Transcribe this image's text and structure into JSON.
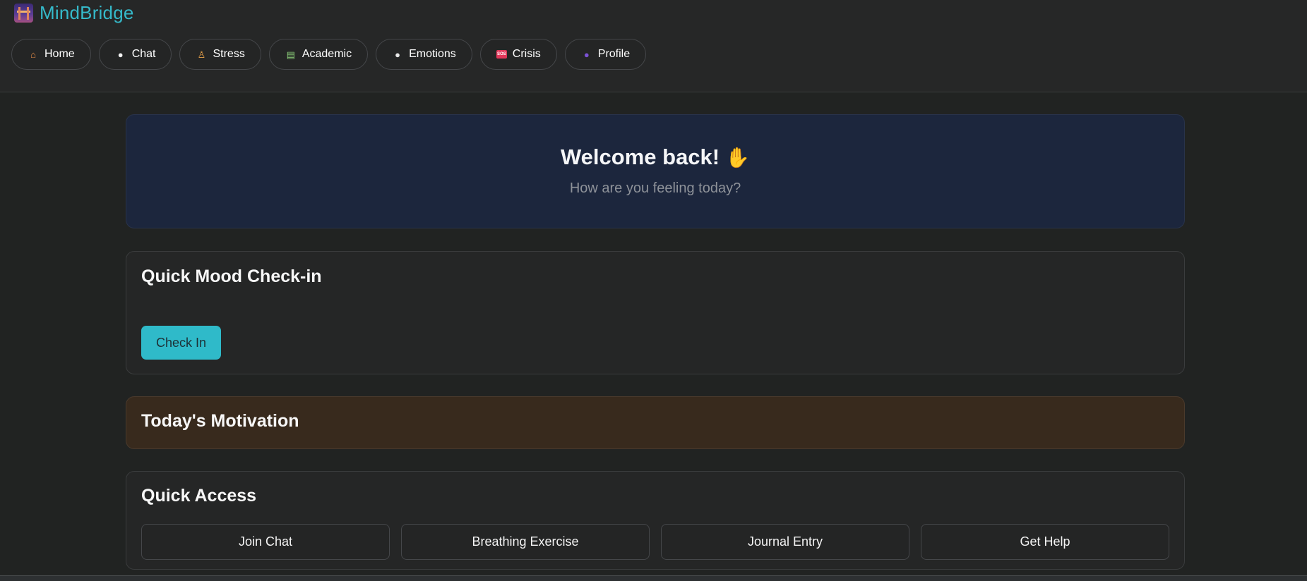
{
  "app": {
    "brand_name": "MindBridge",
    "brand_icon": "bridge-icon",
    "accent_color": "#2fbac9"
  },
  "nav": {
    "items": [
      {
        "label": "Home",
        "icon": "house-icon",
        "glyph": "⌂"
      },
      {
        "label": "Chat",
        "icon": "speech-bubble-icon",
        "glyph": "●"
      },
      {
        "label": "Stress",
        "icon": "meditation-icon",
        "glyph": "♙"
      },
      {
        "label": "Academic",
        "icon": "books-icon",
        "glyph": "▤"
      },
      {
        "label": "Emotions",
        "icon": "thought-bubble-icon",
        "glyph": "●"
      },
      {
        "label": "Crisis",
        "icon": "sos-icon",
        "glyph": "SOS"
      },
      {
        "label": "Profile",
        "icon": "user-silhouette-icon",
        "glyph": "●"
      }
    ]
  },
  "welcome": {
    "title": "Welcome back!",
    "wave_icon": "waving-hand-icon",
    "wave_glyph": "✋",
    "subtitle": "How are you feeling today?"
  },
  "mood_card": {
    "title": "Quick Mood Check-in",
    "button_label": "Check In"
  },
  "motivation_card": {
    "title": "Today's Motivation"
  },
  "quick_access": {
    "title": "Quick Access",
    "buttons": [
      "Join Chat",
      "Breathing Exercise",
      "Journal Entry",
      "Get Help"
    ]
  }
}
